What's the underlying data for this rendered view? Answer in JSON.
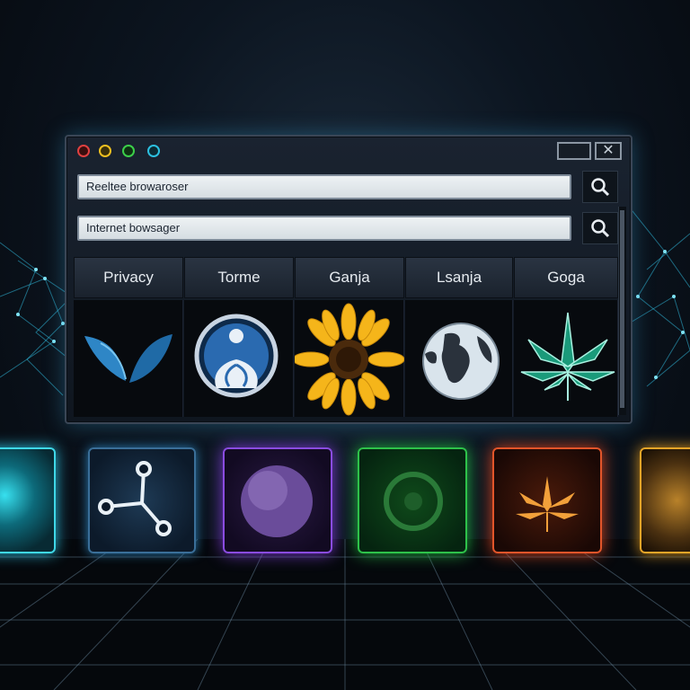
{
  "window": {
    "controls": [
      "close-dot",
      "minimize-dot",
      "zoom-dot",
      "info-dot"
    ],
    "address_bar_1": {
      "value": "Reeltee browaroser"
    },
    "address_bar_2": {
      "value": "Internet bowsager"
    },
    "search_icon": "magnifier-icon",
    "tabs": [
      {
        "label": "Privacy",
        "icon": "v-leaf-icon"
      },
      {
        "label": "Torme",
        "icon": "tor-onion-person-icon"
      },
      {
        "label": "Ganja",
        "icon": "sunflower-icon"
      },
      {
        "label": "Lsanja",
        "icon": "globe-icon"
      },
      {
        "label": "Goga",
        "icon": "cannabis-leaf-icon"
      }
    ],
    "close_glyph": "✕"
  },
  "tiles": [
    {
      "name": "cyan-rock-tile",
      "color": "#33d6e6"
    },
    {
      "name": "share-node-tile",
      "color": "#3aa0d8"
    },
    {
      "name": "purple-planet-tile",
      "color": "#8a4ce0"
    },
    {
      "name": "green-symbol-tile",
      "color": "#2ec24a"
    },
    {
      "name": "orange-leaf-tile",
      "color": "#e2552a"
    },
    {
      "name": "gold-rock-tile",
      "color": "#e8a528"
    }
  ],
  "colors": {
    "accent": "#2cc0e0",
    "window_border": "#3a4656"
  }
}
